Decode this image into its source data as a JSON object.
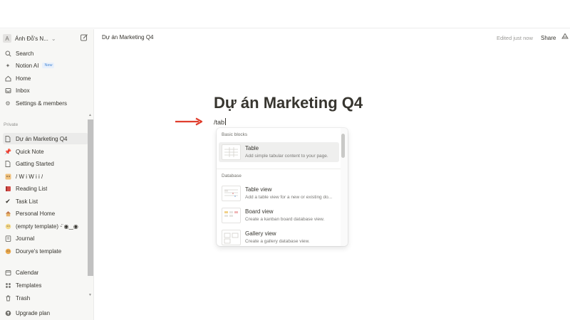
{
  "workspace": {
    "initial": "A",
    "name": "Ánh Đỗ's N..."
  },
  "breadcrumb": "Dự án Marketing Q4",
  "header": {
    "edited": "Edited just now",
    "share": "Share"
  },
  "sidebar": {
    "top_items": [
      {
        "label": "Search",
        "icon": "search-icon"
      },
      {
        "label": "Notion AI",
        "icon": "sparkle-icon",
        "badge": "New"
      },
      {
        "label": "Home",
        "icon": "home-icon"
      },
      {
        "label": "Inbox",
        "icon": "inbox-icon"
      },
      {
        "label": "Settings & members",
        "icon": "gear-icon"
      }
    ],
    "section_label": "Private",
    "pages": [
      {
        "label": "Dự án Marketing Q4",
        "icon": "page-icon",
        "active": true
      },
      {
        "label": "Quick Note",
        "icon": "pin-icon"
      },
      {
        "label": "Gatting Started",
        "icon": "page-icon"
      },
      {
        "label": "/ W i W i i /",
        "icon": "emoji-icon"
      },
      {
        "label": "Reading List",
        "icon": "book-icon"
      },
      {
        "label": "Task List",
        "icon": "check-icon"
      },
      {
        "label": "Personal Home",
        "icon": "house-icon"
      },
      {
        "label": "(empty template) ᵕ̈ ◉‿◉",
        "icon": "emoji-icon"
      },
      {
        "label": "Journal",
        "icon": "journal-icon"
      },
      {
        "label": "Dourye's template",
        "icon": "emoji-icon"
      }
    ],
    "bottom_items": [
      {
        "label": "Calendar",
        "icon": "calendar-icon"
      },
      {
        "label": "Templates",
        "icon": "templates-icon"
      },
      {
        "label": "Trash",
        "icon": "trash-icon"
      }
    ],
    "upgrade": "Upgrade plan"
  },
  "page": {
    "title": "Dự án Marketing Q4",
    "command_text": "/tab"
  },
  "slash_menu": {
    "sections": [
      "Basic blocks",
      "Database"
    ],
    "items": [
      {
        "title": "Table",
        "desc": "Add simple tabular content to your page."
      },
      {
        "title": "Table view",
        "desc": "Add a table view for a new or existing do..."
      },
      {
        "title": "Board view",
        "desc": "Create a kanban board database view."
      },
      {
        "title": "Gallery view",
        "desc": "Create a gallery database view."
      }
    ]
  },
  "colors": {
    "arrow": "#e03e2d",
    "sidebar_bg": "#f7f7f5",
    "text": "#37352f",
    "badge": "#4a8ad6"
  }
}
